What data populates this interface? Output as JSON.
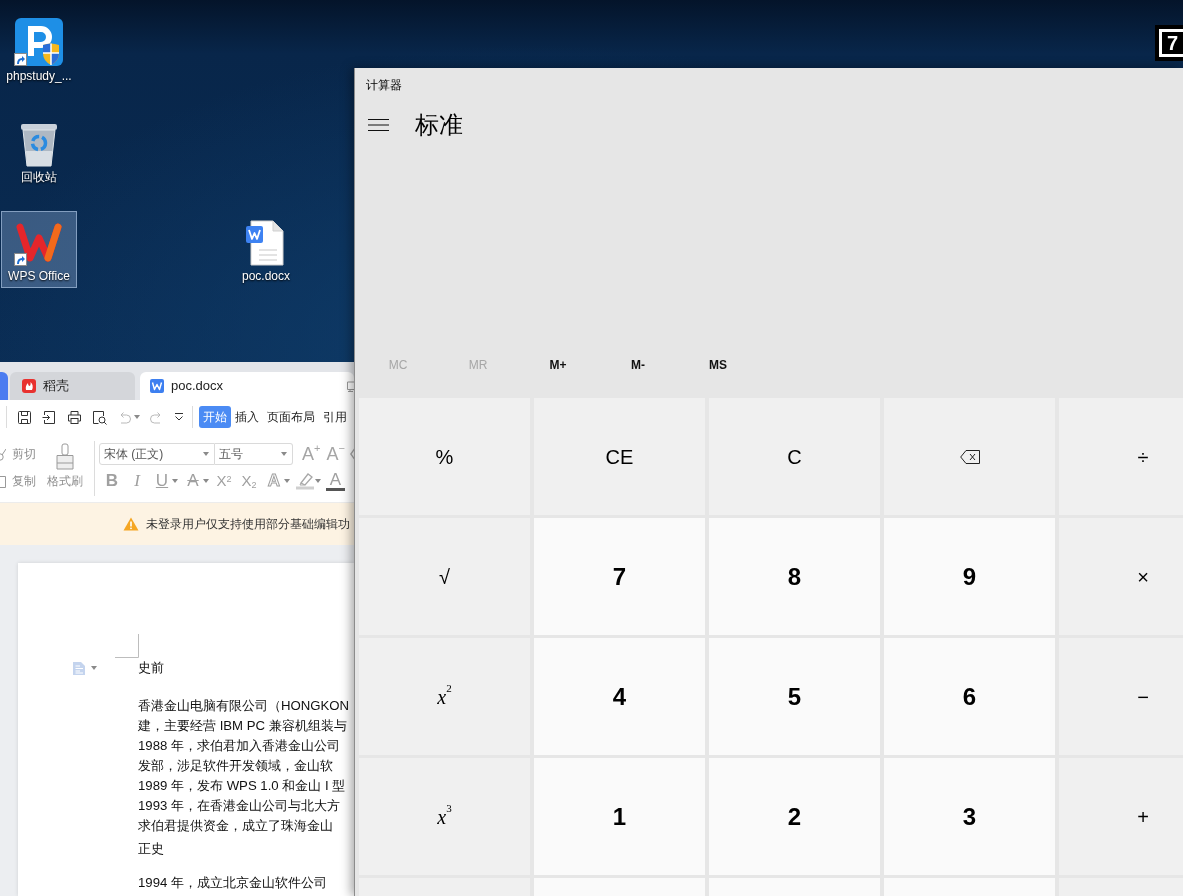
{
  "desktop": {
    "icons": [
      {
        "label": "phpstudy_...",
        "shortcut": true,
        "selected": false
      },
      {
        "label": "回收站",
        "shortcut": false,
        "selected": false
      },
      {
        "label": "WPS Office",
        "shortcut": true,
        "selected": true
      },
      {
        "label": "poc.docx",
        "shortcut": false,
        "selected": false
      }
    ],
    "corner_app": {
      "glyph": "7"
    }
  },
  "wps_window": {
    "tabs": [
      {
        "label": "稻壳",
        "selected": false
      },
      {
        "label": "poc.docx",
        "selected": true
      }
    ],
    "quick_access": [
      {
        "disabled": false
      },
      {
        "disabled": false
      },
      {
        "disabled": false
      },
      {
        "disabled": false
      },
      {
        "disabled": true
      },
      {
        "disabled": true
      },
      {
        "disabled": false
      }
    ],
    "ribbon_tabs": [
      {
        "label": "开始",
        "selected": true
      },
      {
        "label": "插入",
        "selected": false
      },
      {
        "label": "页面布局",
        "selected": false
      },
      {
        "label": "引用",
        "selected": false
      }
    ],
    "clipboard": [
      {
        "label": "剪切",
        "disabled": true
      },
      {
        "label": "复制",
        "disabled": true
      },
      {
        "label": "格式刷",
        "disabled": true
      }
    ],
    "font_name": {
      "value": "宋体 (正文)"
    },
    "font_size": {
      "value": "五号"
    },
    "size_buttons": [
      {
        "label": "A$^{+}$",
        "disabled": true
      },
      {
        "label": "A$^{−}$",
        "disabled": true
      }
    ],
    "format_buttons": [
      {
        "kind": "bold",
        "label": "B",
        "menu": false,
        "disabled": true
      },
      {
        "kind": "italic",
        "label": "I",
        "menu": false,
        "disabled": true
      },
      {
        "kind": "underline",
        "label": "U",
        "menu": true,
        "disabled": true
      },
      {
        "kind": "strike",
        "label": "A",
        "menu": true,
        "disabled": true
      },
      {
        "kind": "superscript",
        "label": "X$^{2}$",
        "menu": false,
        "disabled": true
      },
      {
        "kind": "subscript",
        "label": "X$_{2}$",
        "menu": false,
        "disabled": true
      },
      {
        "kind": "outline",
        "label": "A",
        "menu": true,
        "disabled": true
      },
      {
        "kind": "highlight",
        "menu": true,
        "disabled": true
      },
      {
        "kind": "color",
        "label": "A",
        "menu": false,
        "disabled": true
      }
    ],
    "notice": "未登录用户仅支持使用部分基础编辑功",
    "document": [
      {
        "kind": "heading",
        "text": "史前"
      },
      {
        "kind": "paragraph",
        "lines": [
          "香港金山电脑有限公司（HONGKON",
          "建，主要经营 IBM PC 兼容机组装与",
          "1988 年，求伯君加入香港金山公司",
          "发部，涉足软件开发领域，金山软",
          "1989 年，发布 WPS 1.0 和金山 I 型",
          "1993 年，在香港金山公司与北大方",
          "求伯君提供资金，成立了珠海金山"
        ]
      },
      {
        "kind": "heading",
        "text": "正史"
      },
      {
        "kind": "paragraph",
        "lines": [
          "1994 年，成立北京金山软件公司"
        ]
      }
    ]
  },
  "calculator": {
    "title": "计算器",
    "mode": "标准",
    "memory": [
      {
        "label": "MC",
        "disabled": true
      },
      {
        "label": "MR",
        "disabled": true
      },
      {
        "label": "M+",
        "disabled": false
      },
      {
        "label": "M-",
        "disabled": false
      },
      {
        "label": "MS",
        "disabled": false
      }
    ],
    "keys": [
      {
        "kind": "function",
        "label": "%"
      },
      {
        "kind": "function",
        "label": "CE"
      },
      {
        "kind": "function",
        "label": "C"
      },
      {
        "kind": "backspace"
      },
      {
        "kind": "function",
        "label": "÷"
      },
      {
        "kind": "function",
        "label": "√"
      },
      {
        "kind": "digit",
        "label": "7"
      },
      {
        "kind": "digit",
        "label": "8"
      },
      {
        "kind": "digit",
        "label": "9"
      },
      {
        "kind": "function",
        "label": "×"
      },
      {
        "kind": "function",
        "label": "*x*$^{2}$"
      },
      {
        "kind": "digit",
        "label": "4"
      },
      {
        "kind": "digit",
        "label": "5"
      },
      {
        "kind": "digit",
        "label": "6"
      },
      {
        "kind": "function",
        "label": "−"
      },
      {
        "kind": "function",
        "label": "*x*$^{3}$"
      },
      {
        "kind": "digit",
        "label": "1"
      },
      {
        "kind": "digit",
        "label": "2"
      },
      {
        "kind": "digit",
        "label": "3"
      },
      {
        "kind": "function",
        "label": "+"
      },
      {
        "kind": "function"
      },
      {
        "kind": "digit"
      },
      {
        "kind": "digit"
      },
      {
        "kind": "digit"
      },
      {
        "kind": "function"
      }
    ]
  }
}
